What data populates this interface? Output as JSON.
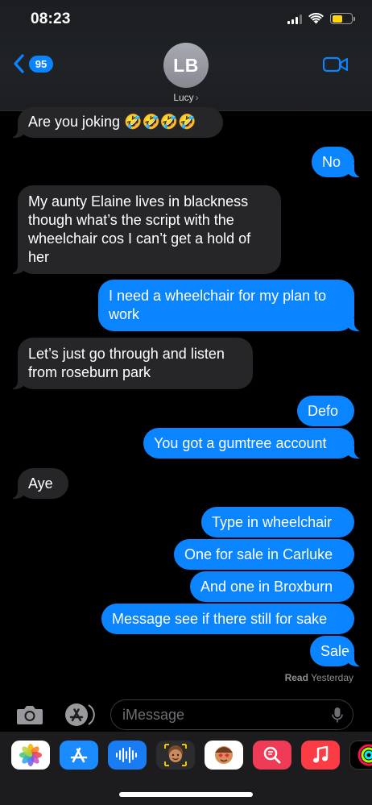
{
  "status_bar": {
    "time": "08:23"
  },
  "header": {
    "back_count": "95",
    "avatar_initials": "LB",
    "contact_name": "Lucy"
  },
  "messages": [
    {
      "dir": "in",
      "text": "Are you joking 🤣🤣🤣🤣"
    },
    {
      "dir": "out",
      "text": "No"
    },
    {
      "dir": "in",
      "text": "My aunty Elaine lives in blackness though what’s the script with the wheelchair cos I can’t get a hold of her"
    },
    {
      "dir": "out",
      "text": "I need a wheelchair for my plan to work"
    },
    {
      "dir": "in",
      "text": "Let’s just go through and listen from roseburn park"
    },
    {
      "dir": "out",
      "text": "Defo"
    },
    {
      "dir": "out",
      "text": "You got a gumtree account"
    },
    {
      "dir": "in",
      "text": "Aye"
    },
    {
      "dir": "out",
      "text": "Type in wheelchair"
    },
    {
      "dir": "out",
      "text": "One for sale in Carluke"
    },
    {
      "dir": "out",
      "text": "And one in Broxburn"
    },
    {
      "dir": "out",
      "text": "Message see if there still for sake"
    },
    {
      "dir": "out",
      "text": "Sale"
    }
  ],
  "read_receipt": {
    "label": "Read",
    "time": "Yesterday"
  },
  "composer": {
    "placeholder": "iMessage"
  },
  "app_drawer": [
    "photos-app",
    "app-store",
    "audio-message",
    "memoji",
    "memoji-stickers",
    "search-images",
    "music",
    "fitness"
  ],
  "colors": {
    "sent": "#0a84ff",
    "received": "#262629",
    "background": "#000000"
  }
}
